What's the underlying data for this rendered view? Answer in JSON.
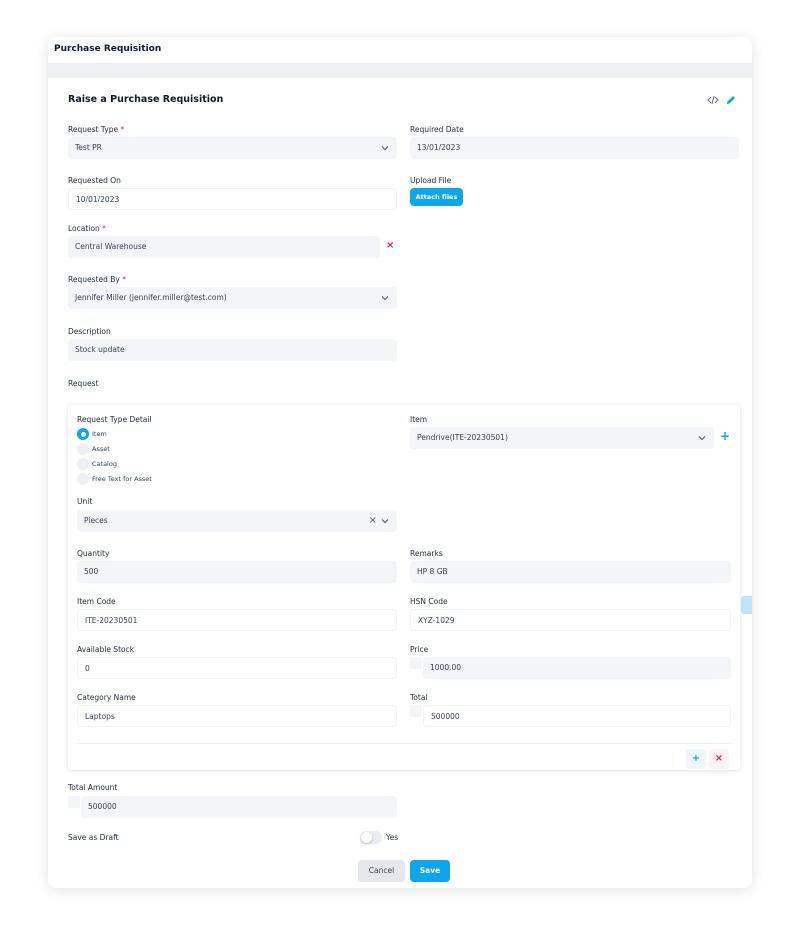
{
  "window": {
    "title": "Purchase Requisition"
  },
  "form": {
    "title": "Raise a Purchase Requisition",
    "code_icon": "code-icon",
    "edit_icon": "pencil-icon",
    "request_type": {
      "label": "Request Type",
      "required": "*",
      "value": "Test PR"
    },
    "required_date": {
      "label": "Required Date",
      "value": "13/01/2023"
    },
    "requested_on": {
      "label": "Requested On",
      "value": "10/01/2023"
    },
    "upload_file": {
      "label": "Upload File",
      "button": "Attach files"
    },
    "location": {
      "label": "Location",
      "required": "*",
      "value": "Central Warehouse",
      "clear": "×"
    },
    "requested_by": {
      "label": "Requested By",
      "required": "*",
      "value": "Jennifer Miller (jennifer.miller@test.com)"
    },
    "description": {
      "label": "Description",
      "value": "Stock update"
    },
    "request_section_label": "Request"
  },
  "request_item": {
    "type_detail_label": "Request Type Detail",
    "type_options": [
      "Item",
      "Asset",
      "Catalog",
      "Free Text for Asset"
    ],
    "type_selected": "Item",
    "item": {
      "label": "Item",
      "value": "Pendrive(ITE-20230501)",
      "add": "+"
    },
    "unit": {
      "label": "Unit",
      "value": "Pieces",
      "clear": "×"
    },
    "quantity": {
      "label": "Quantity",
      "value": "500"
    },
    "remarks": {
      "label": "Remarks",
      "value": "HP 8 GB"
    },
    "item_code": {
      "label": "Item Code",
      "value": "ITE-20230501"
    },
    "hsn_code": {
      "label": "HSN Code",
      "value": "XYZ-1029"
    },
    "available_stock": {
      "label": "Available Stock",
      "value": "0"
    },
    "price": {
      "label": "Price",
      "value": "1000.00"
    },
    "category_name": {
      "label": "Category Name",
      "value": "Laptops"
    },
    "total": {
      "label": "Total",
      "value": "500000"
    },
    "add_row": "+",
    "remove_row": "×"
  },
  "footer": {
    "total_amount": {
      "label": "Total Amount",
      "value": "500000"
    },
    "save_as_draft": {
      "label": "Save as Draft",
      "toggle_label": "Yes",
      "on": false
    },
    "cancel": "Cancel",
    "save": "Save"
  },
  "colors": {
    "accent": "#0ea5e9",
    "danger": "#e11d48",
    "field_bg": "#f3f5f8"
  }
}
